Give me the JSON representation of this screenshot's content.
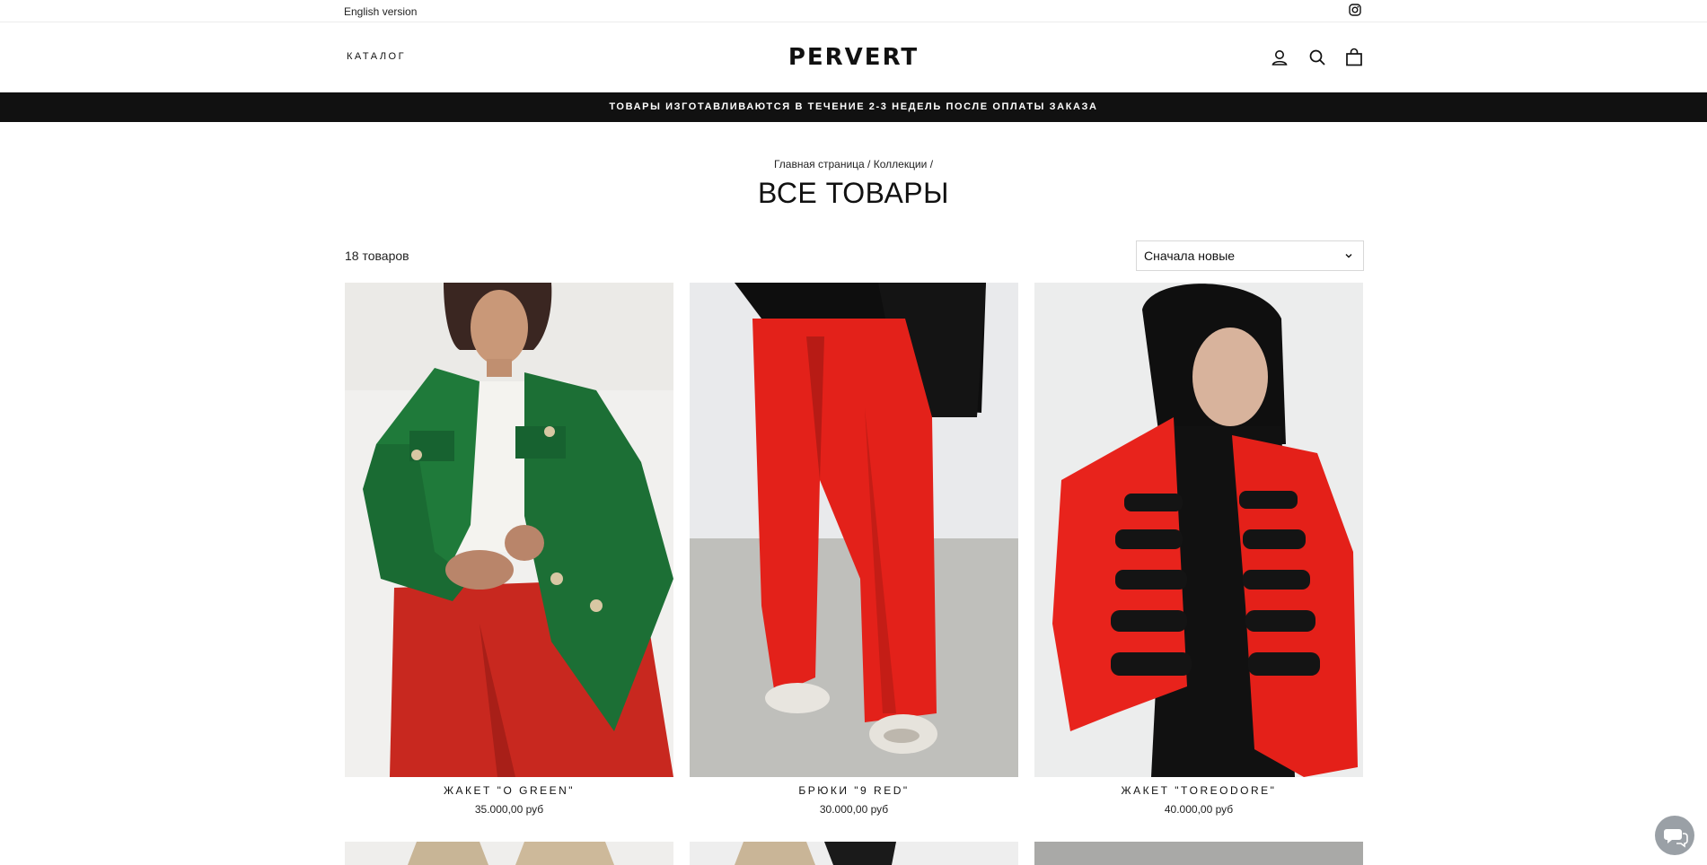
{
  "topbar": {
    "language_link": "English version",
    "instagram_icon": "instagram-icon"
  },
  "header": {
    "catalog_label": "КАТАЛОГ",
    "logo_text": "PERVERT",
    "icons": [
      "account-icon",
      "search-icon",
      "cart-icon"
    ]
  },
  "announcement": "ТОВАРЫ ИЗГОТАВЛИВАЮТСЯ В ТЕЧЕНИЕ 2-3 НЕДЕЛЬ ПОСЛЕ ОПЛАТЫ ЗАКАЗА",
  "breadcrumb": {
    "home": "Главная страница",
    "separator": "/",
    "collections": "Коллекции"
  },
  "page_title": "ВСЕ ТОВАРЫ",
  "collection": {
    "count_label": "18 товаров",
    "sort_selected": "Сначала новые"
  },
  "products": [
    {
      "title": "ЖАКЕТ \"O GREEN\"",
      "price": "35.000,00 руб"
    },
    {
      "title": "БРЮКИ \"9 RED\"",
      "price": "30.000,00 руб"
    },
    {
      "title": "ЖАКЕТ \"TOREODORE\"",
      "price": "40.000,00 руб"
    }
  ],
  "colors": {
    "announcement_bg": "#111111",
    "green_jacket": "#1f7a3a",
    "red": "#e0261d"
  },
  "chat_icon": "chat-icon"
}
